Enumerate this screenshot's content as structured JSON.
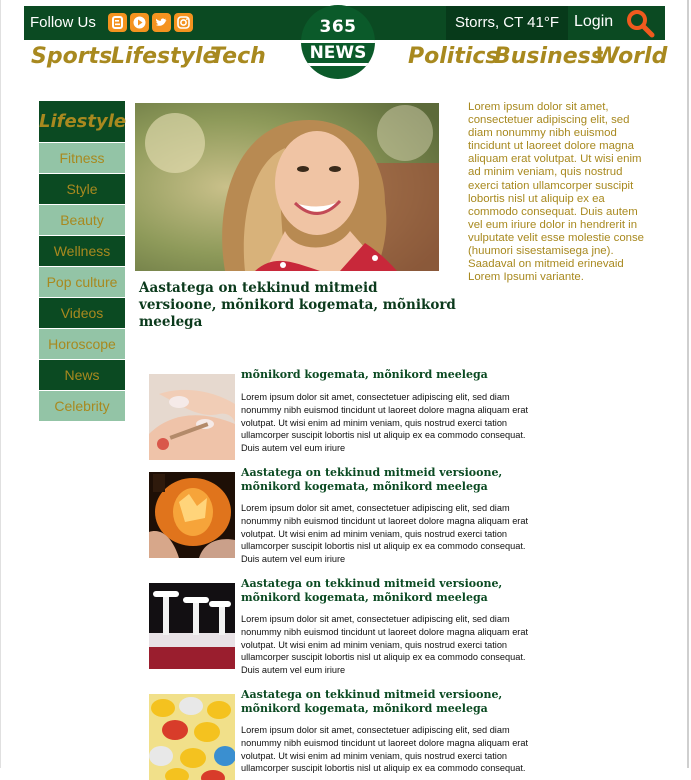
{
  "topbar": {
    "follow_label": "Follow Us",
    "social": [
      "blogger-icon",
      "youtube-icon",
      "twitter-icon",
      "instagram-icon"
    ],
    "weather": "Storrs, CT 41°F",
    "login": "Login"
  },
  "logo": {
    "top": "365",
    "bottom": "NEWS"
  },
  "nav": {
    "left": [
      "Sports",
      "Lifestyle",
      "Tech"
    ],
    "right": [
      "Politics",
      "Business",
      "World"
    ]
  },
  "sidebar": {
    "heading": "Lifestyle",
    "items": [
      "Fitness",
      "Style",
      "Beauty",
      "Wellness",
      "Pop culture",
      "Videos",
      "Horoscope",
      "News",
      "Celebrity"
    ]
  },
  "hero": {
    "title": "Aastatega on tekkinud mitmeid versioone, mõnikord kogemata, mõnikord meelega",
    "lead": "Lorem ipsum dolor sit amet, consectetuer adipiscing elit, sed diam nonummy nibh euismod tincidunt ut laoreet dolore magna aliquam erat volutpat. Ut wisi enim ad minim veniam, quis nostrud exerci tation ullamcorper suscipit lobortis nisl ut aliquip ex ea commodo consequat. Duis autem vel eum iriure dolor in hendrerit in vulputate velit esse molestie conse (huumori sisestamisega jne). Saadaval on mitmeid erinevaid Lorem Ipsumi variante."
  },
  "articles": [
    {
      "title": "mõnikord kogemata, mõnikord meelega",
      "body": "Lorem ipsum dolor sit amet, consectetuer adipiscing elit, sed diam nonummy nibh euismod tincidunt ut laoreet dolore magna aliquam erat volutpat. Ut wisi enim ad minim veniam, quis nostrud exerci tation ullamcorper suscipit lobortis nisl ut aliquip ex ea commodo consequat. Duis autem vel eum iriure"
    },
    {
      "title": "Aastatega on tekkinud mitmeid versioone, mõnikord kogemata, mõnikord meelega",
      "body": "Lorem ipsum dolor sit amet, consectetuer adipiscing elit, sed diam nonummy nibh euismod tincidunt ut laoreet dolore magna aliquam erat volutpat. Ut wisi enim ad minim veniam, quis nostrud exerci tation ullamcorper suscipit lobortis nisl ut aliquip ex ea commodo consequat. Duis autem vel eum iriure"
    },
    {
      "title": "Aastatega on tekkinud mitmeid versioone, mõnikord kogemata, mõnikord meelega",
      "body": "Lorem ipsum dolor sit amet, consectetuer adipiscing elit, sed diam nonummy nibh euismod tincidunt ut laoreet dolore magna aliquam erat volutpat. Ut wisi enim ad minim veniam, quis nostrud exerci tation ullamcorper suscipit lobortis nisl ut aliquip ex ea commodo consequat. Duis autem vel eum iriure"
    },
    {
      "title": "Aastatega on tekkinud mitmeid versioone, mõnikord kogemata, mõnikord meelega",
      "body": "Lorem ipsum dolor sit amet, consectetuer adipiscing elit, sed diam nonummy nibh euismod tincidunt ut laoreet dolore magna aliquam erat volutpat. Ut wisi enim ad minim veniam, quis nostrud exerci tation ullamcorper suscipit lobortis nisl ut aliquip ex ea commodo consequat."
    }
  ],
  "colors": {
    "brand_green": "#0b4a22",
    "light_green": "#93c4a6",
    "gold": "#a8891f",
    "social_orange": "#f4931f",
    "search_orange": "#f05a1e"
  }
}
